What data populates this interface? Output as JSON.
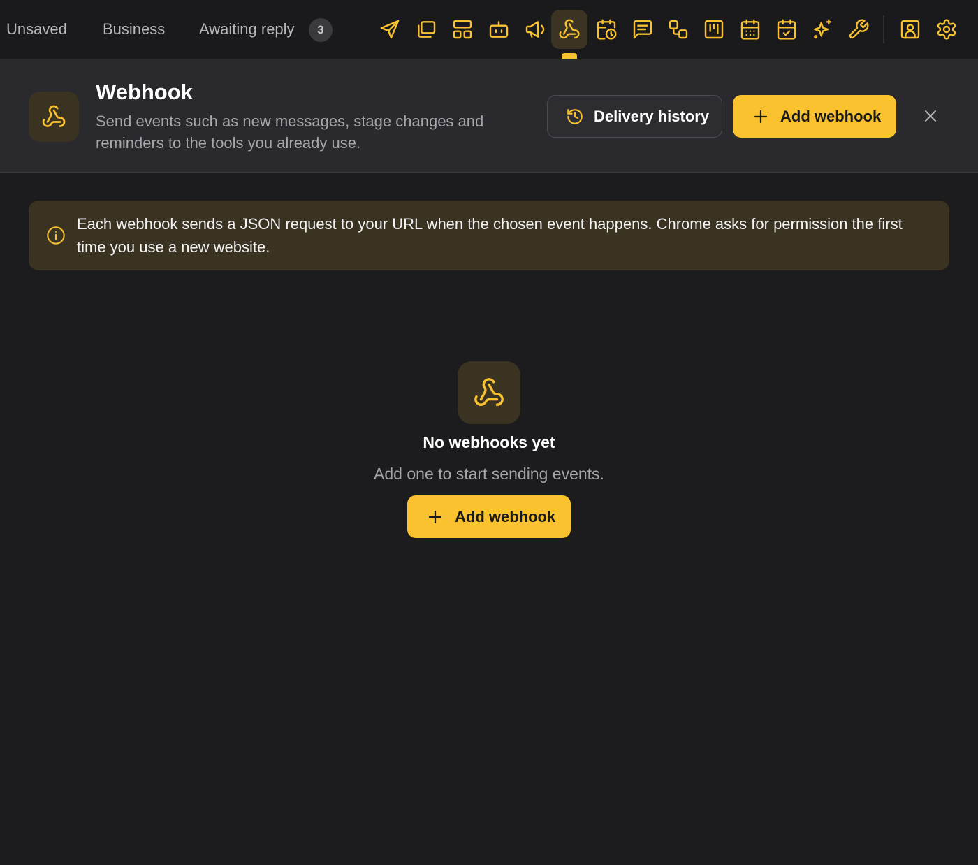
{
  "colors": {
    "accent": "#f9c22e",
    "accent_icon": "#f7c12f",
    "background": "#1c1c1f",
    "panel": "#2a2a2e",
    "info_bg": "#3b3322"
  },
  "topbar": {
    "tabs": [
      {
        "label": "Unsaved"
      },
      {
        "label": "Business"
      },
      {
        "label": "Awaiting reply",
        "badge": "3"
      }
    ],
    "tools": [
      {
        "icon": "send-icon"
      },
      {
        "icon": "copy-icon"
      },
      {
        "icon": "layout-icon"
      },
      {
        "icon": "bot-icon"
      },
      {
        "icon": "megaphone-icon"
      },
      {
        "icon": "webhook-icon",
        "active": true
      },
      {
        "icon": "calendar-clock-icon"
      },
      {
        "icon": "message-square-icon"
      },
      {
        "icon": "workflow-icon"
      },
      {
        "icon": "kanban-icon"
      },
      {
        "icon": "calendar-grid-icon"
      },
      {
        "icon": "calendar-check-icon"
      },
      {
        "icon": "sparkles-icon"
      },
      {
        "icon": "wrench-icon"
      },
      {
        "icon": "contact-icon"
      },
      {
        "icon": "settings-icon"
      }
    ]
  },
  "header": {
    "title": "Webhook",
    "description": "Send events such as new messages, stage changes and reminders to the tools you already use.",
    "history_button": "Delivery history",
    "add_button": "Add webhook"
  },
  "info": {
    "text": "Each webhook sends a JSON request to your URL when the chosen event happens. Chrome asks for permission the first time you use a new website."
  },
  "empty_state": {
    "title": "No webhooks yet",
    "subtitle": "Add one to start sending events.",
    "add_button": "Add webhook"
  }
}
